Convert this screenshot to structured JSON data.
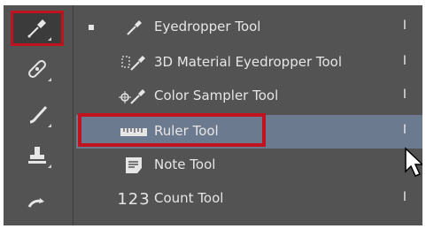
{
  "toolbar": {
    "tools": [
      {
        "icon": "eyedropper-icon",
        "selected": true
      },
      {
        "icon": "healing-brush-icon",
        "selected": false
      },
      {
        "icon": "brush-icon",
        "selected": false
      },
      {
        "icon": "clone-stamp-icon",
        "selected": false
      },
      {
        "icon": "history-brush-icon",
        "selected": false
      }
    ]
  },
  "menu": {
    "items": [
      {
        "label": "Eyedropper Tool",
        "shortcut": "I",
        "icon": "eyedropper-icon",
        "active": true
      },
      {
        "label": "3D Material Eyedropper Tool",
        "shortcut": "I",
        "icon": "3d-material-eyedropper-icon"
      },
      {
        "label": "Color Sampler Tool",
        "shortcut": "I",
        "icon": "color-sampler-icon"
      },
      {
        "label": "Ruler Tool",
        "shortcut": "I",
        "icon": "ruler-icon",
        "hovered": true
      },
      {
        "label": "Note Tool",
        "shortcut": "",
        "icon": "note-icon"
      },
      {
        "label": "Count Tool",
        "shortcut": "I",
        "icon": "count-icon",
        "icon_text": "123"
      }
    ]
  },
  "colors": {
    "panel_bg": "#535353",
    "hover_bg": "#6c7a8f",
    "highlight_red": "#c1121f",
    "text": "#e6e6e6"
  }
}
